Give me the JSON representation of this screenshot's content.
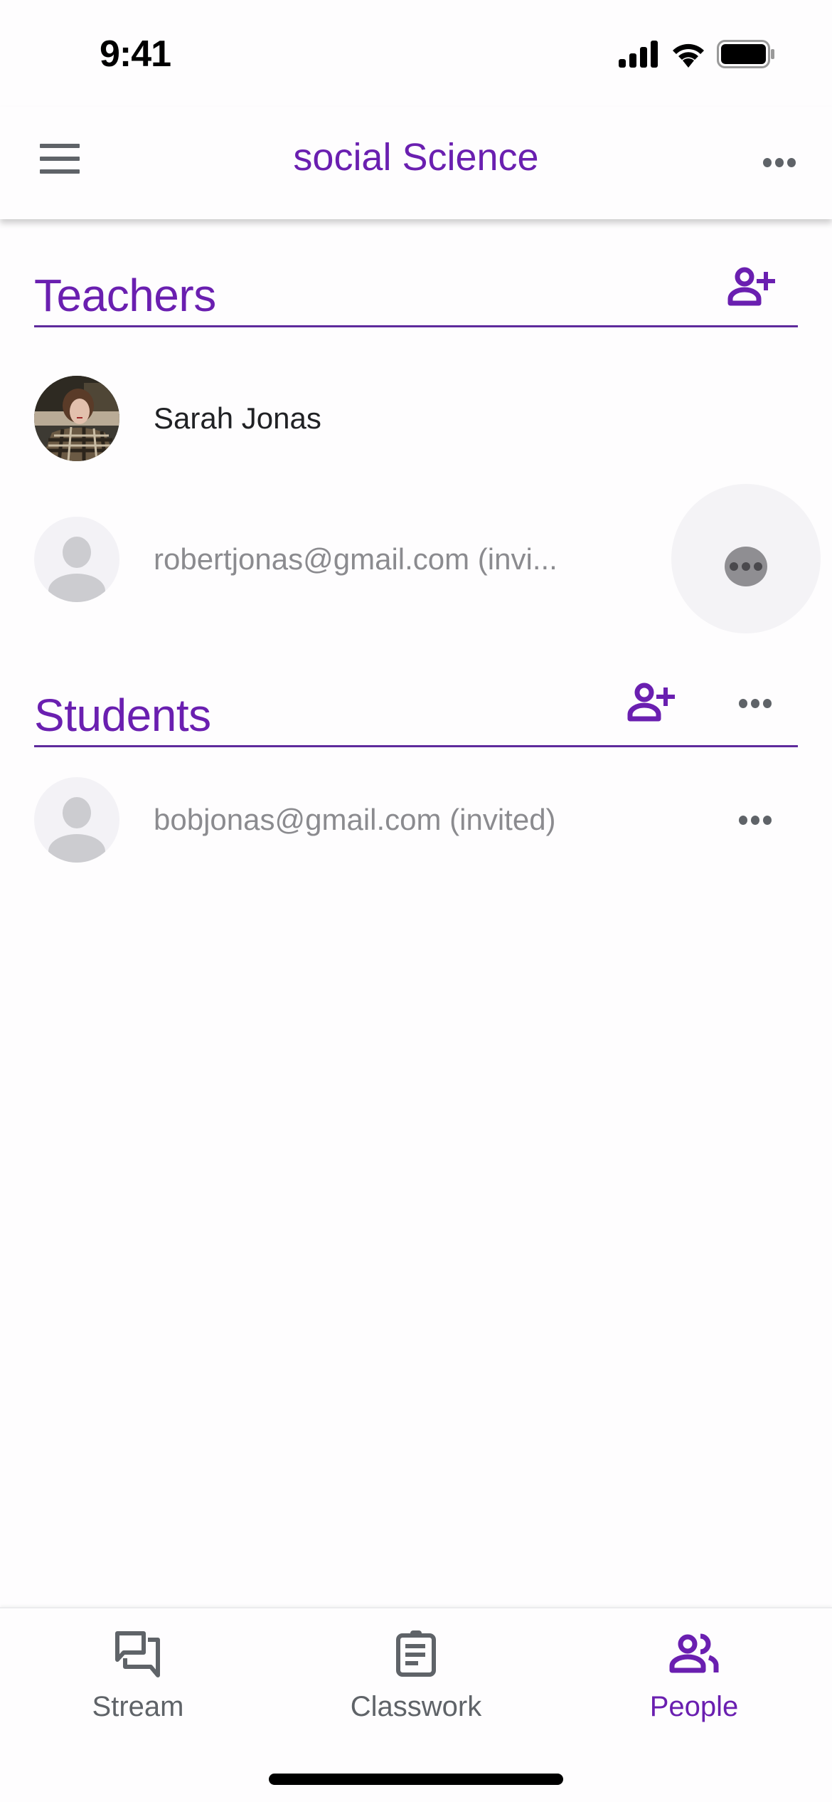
{
  "status_bar": {
    "time": "9:41",
    "icons": [
      "cellular-signal-icon",
      "wifi-icon",
      "battery-icon"
    ]
  },
  "app_bar": {
    "menu_icon": "hamburger-menu-icon",
    "title": "social Science",
    "more_icon": "more-horizontal-icon"
  },
  "teachers": {
    "title": "Teachers",
    "add_icon": "person-add-icon",
    "members": [
      {
        "name": "Sarah Jonas",
        "avatar": "photo",
        "invited": false
      },
      {
        "name": "robertjonas@gmail.com (invi...",
        "avatar": "placeholder",
        "invited": true,
        "more_icon": "more-horizontal-icon",
        "more_pressed": true
      }
    ]
  },
  "students": {
    "title": "Students",
    "add_icon": "person-add-icon",
    "more_icon": "more-horizontal-icon",
    "members": [
      {
        "name": "bobjonas@gmail.com (invited)",
        "avatar": "placeholder",
        "invited": true,
        "more_icon": "more-horizontal-icon"
      }
    ]
  },
  "bottom_nav": {
    "items": [
      {
        "label": "Stream",
        "icon": "stream-chat-icon",
        "active": false
      },
      {
        "label": "Classwork",
        "icon": "clipboard-icon",
        "active": false
      },
      {
        "label": "People",
        "icon": "people-icon",
        "active": true
      }
    ]
  },
  "colors": {
    "accent": "#6a1fb0",
    "divider": "#5e2a9c",
    "icon_grey": "#5f6368",
    "muted_text": "#8b8b8f"
  }
}
